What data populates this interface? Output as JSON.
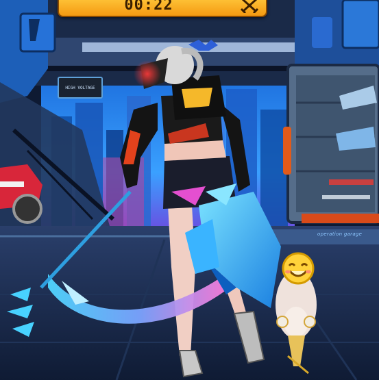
{
  "hud": {
    "timer": "00:22",
    "timer_icon": "crossed-swords-icon"
  },
  "scene": {
    "wall_sign_text": "HIGH VOLTAGE",
    "floor_sign_text": "operation garage"
  },
  "pet": {
    "emote": "smiling-face-emote-icon"
  },
  "colors": {
    "timer_bg": "#f6a91e",
    "corridor_blue": "#1c4fa0",
    "scythe_blue": "#3fc6ff",
    "scythe_pink": "#d76bff"
  }
}
